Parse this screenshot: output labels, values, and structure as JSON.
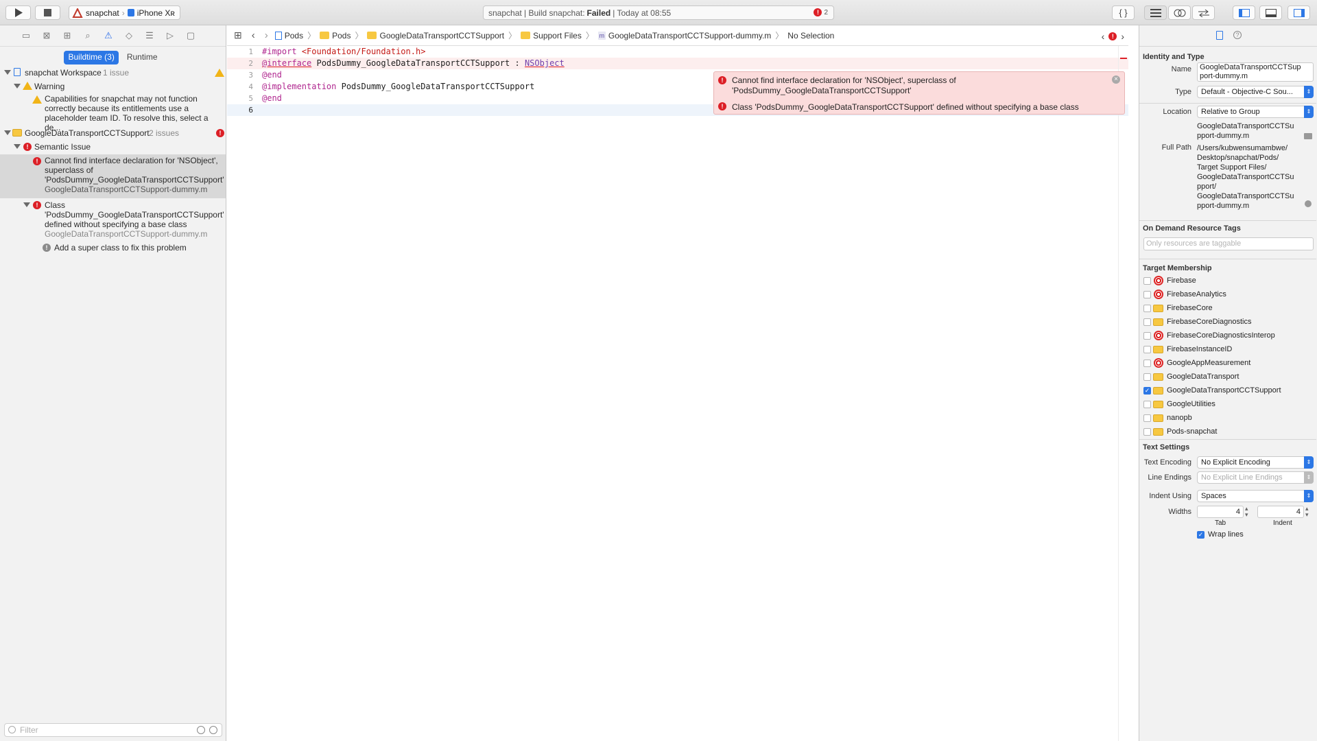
{
  "toolbar": {
    "scheme_name": "snapchat",
    "device_name": "iPhone Xʀ",
    "status_prefix": "snapchat | Build snapchat:",
    "status_state": "Failed",
    "status_time": "| Today at 08:55",
    "error_count": "2"
  },
  "navigator": {
    "tabs": {
      "buildtime": "Buildtime (3)",
      "runtime": "Runtime"
    },
    "workspace": {
      "name": "snapchat Workspace",
      "count": "1 issue"
    },
    "warning_group": "Warning",
    "warning_text_1": "Capabilities for snapchat may not function",
    "warning_text_2": "correctly because its entitlements use a",
    "warning_text_3": "placeholder team ID. To resolve this, select a de...",
    "pod": {
      "name": "GoogleDataTransportCCTSupport",
      "count": "2 issues"
    },
    "semantic_group": "Semantic Issue",
    "issue1_line1": "Cannot find interface declaration for 'NSObject',",
    "issue1_line2": "superclass of",
    "issue1_line3": "'PodsDummy_GoogleDataTransportCCTSupport'",
    "issue1_file": "GoogleDataTransportCCTSupport-dummy.m",
    "issue2_line1": "Class",
    "issue2_line2": "'PodsDummy_GoogleDataTransportCCTSupport'",
    "issue2_line3": "defined without specifying a base class",
    "issue2_file": "GoogleDataTransportCCTSupport-dummy.m",
    "fixit": "Add a super class to fix this problem",
    "filter_placeholder": "Filter"
  },
  "jumpbar": {
    "crumbs": [
      "Pods",
      "Pods",
      "GoogleDataTransportCCTSupport",
      "Support Files",
      "GoogleDataTransportCCTSupport-dummy.m",
      "No Selection"
    ]
  },
  "code": {
    "line_numbers": [
      "1",
      "2",
      "3",
      "4",
      "5",
      "6"
    ],
    "l1_kw": "#import",
    "l1_str": "<Foundation/Foundation.h>",
    "l2_kw": "@interface",
    "l2_name": "PodsDummy_GoogleDataTransportCCTSupport",
    "l2_colon": ":",
    "l2_cls": "NSObject",
    "l3": "@end",
    "l4_kw": "@implementation",
    "l4_name": "PodsDummy_GoogleDataTransportCCTSupport",
    "l5": "@end"
  },
  "popup": {
    "err1_line1": "Cannot find interface declaration for 'NSObject', superclass of",
    "err1_line2": "'PodsDummy_GoogleDataTransportCCTSupport'",
    "err2": "Class 'PodsDummy_GoogleDataTransportCCTSupport' defined without specifying a base class"
  },
  "inspector": {
    "identity_header": "Identity and Type",
    "name_label": "Name",
    "name_value_1": "GoogleDataTransportCCTSup",
    "name_value_2": "port-dummy.m",
    "type_label": "Type",
    "type_value": "Default - Objective-C Sou...",
    "location_label": "Location",
    "location_value": "Relative to Group",
    "rel_path_1": "GoogleDataTransportCCTSu",
    "rel_path_2": "pport-dummy.m",
    "fullpath_label": "Full Path",
    "fullpath_lines": [
      "/Users/kubwensumambwe/",
      "Desktop/snapchat/Pods/",
      "Target Support Files/",
      "GoogleDataTransportCCTSu",
      "pport/",
      "GoogleDataTransportCCTSu",
      "pport-dummy.m"
    ],
    "odr_header": "On Demand Resource Tags",
    "odr_placeholder": "Only resources are taggable",
    "membership_header": "Target Membership",
    "targets": [
      {
        "name": "Firebase",
        "icon": "target",
        "checked": false
      },
      {
        "name": "FirebaseAnalytics",
        "icon": "target",
        "checked": false
      },
      {
        "name": "FirebaseCore",
        "icon": "toolbox",
        "checked": false
      },
      {
        "name": "FirebaseCoreDiagnostics",
        "icon": "toolbox",
        "checked": false
      },
      {
        "name": "FirebaseCoreDiagnosticsInterop",
        "icon": "target",
        "checked": false
      },
      {
        "name": "FirebaseInstanceID",
        "icon": "toolbox",
        "checked": false
      },
      {
        "name": "GoogleAppMeasurement",
        "icon": "target",
        "checked": false
      },
      {
        "name": "GoogleDataTransport",
        "icon": "toolbox",
        "checked": false
      },
      {
        "name": "GoogleDataTransportCCTSupport",
        "icon": "toolbox",
        "checked": true
      },
      {
        "name": "GoogleUtilities",
        "icon": "toolbox",
        "checked": false
      },
      {
        "name": "nanopb",
        "icon": "toolbox",
        "checked": false
      },
      {
        "name": "Pods-snapchat",
        "icon": "toolbox",
        "checked": false
      }
    ],
    "text_settings_header": "Text Settings",
    "encoding_label": "Text Encoding",
    "encoding_value": "No Explicit Encoding",
    "endings_label": "Line Endings",
    "endings_value": "No Explicit Line Endings",
    "indent_label": "Indent Using",
    "indent_value": "Spaces",
    "widths_label": "Widths",
    "tab_value": "4",
    "indent_width_value": "4",
    "tab_caption": "Tab",
    "indent_caption": "Indent",
    "wrap_label": "Wrap lines"
  }
}
